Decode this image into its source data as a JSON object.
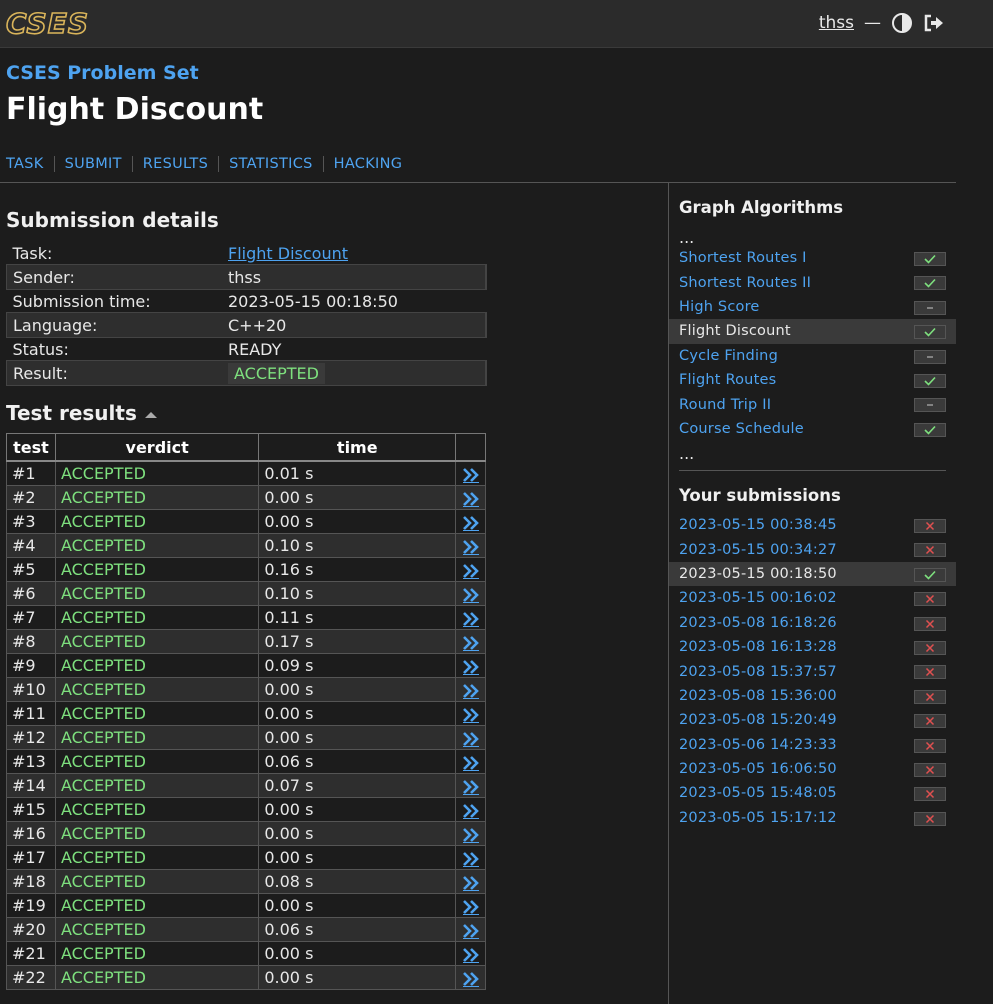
{
  "header": {
    "logo_text": "CSES",
    "username": "thss",
    "separator": "—",
    "theme_icon": "half-circle-contrast",
    "logout_icon": "sign-out-arrow"
  },
  "site": "CSES Problem Set",
  "title": "Flight Discount",
  "tabs": [
    "TASK",
    "SUBMIT",
    "RESULTS",
    "STATISTICS",
    "HACKING"
  ],
  "details": {
    "heading": "Submission details",
    "rows": [
      {
        "label": "Task:",
        "value": "Flight Discount"
      },
      {
        "label": "Sender:",
        "value": "thss"
      },
      {
        "label": "Submission time:",
        "value": "2023-05-15 00:18:50"
      },
      {
        "label": "Language:",
        "value": "C++20"
      },
      {
        "label": "Status:",
        "value": "READY"
      },
      {
        "label": "Result:",
        "value": "ACCEPTED"
      }
    ]
  },
  "tests": {
    "heading": "Test results",
    "columns": [
      "test",
      "verdict",
      "time"
    ],
    "rows": [
      {
        "test": "#1",
        "verdict": "ACCEPTED",
        "time": "0.01 s"
      },
      {
        "test": "#2",
        "verdict": "ACCEPTED",
        "time": "0.00 s"
      },
      {
        "test": "#3",
        "verdict": "ACCEPTED",
        "time": "0.00 s"
      },
      {
        "test": "#4",
        "verdict": "ACCEPTED",
        "time": "0.10 s"
      },
      {
        "test": "#5",
        "verdict": "ACCEPTED",
        "time": "0.16 s"
      },
      {
        "test": "#6",
        "verdict": "ACCEPTED",
        "time": "0.10 s"
      },
      {
        "test": "#7",
        "verdict": "ACCEPTED",
        "time": "0.11 s"
      },
      {
        "test": "#8",
        "verdict": "ACCEPTED",
        "time": "0.17 s"
      },
      {
        "test": "#9",
        "verdict": "ACCEPTED",
        "time": "0.09 s"
      },
      {
        "test": "#10",
        "verdict": "ACCEPTED",
        "time": "0.00 s"
      },
      {
        "test": "#11",
        "verdict": "ACCEPTED",
        "time": "0.00 s"
      },
      {
        "test": "#12",
        "verdict": "ACCEPTED",
        "time": "0.00 s"
      },
      {
        "test": "#13",
        "verdict": "ACCEPTED",
        "time": "0.06 s"
      },
      {
        "test": "#14",
        "verdict": "ACCEPTED",
        "time": "0.07 s"
      },
      {
        "test": "#15",
        "verdict": "ACCEPTED",
        "time": "0.00 s"
      },
      {
        "test": "#16",
        "verdict": "ACCEPTED",
        "time": "0.00 s"
      },
      {
        "test": "#17",
        "verdict": "ACCEPTED",
        "time": "0.00 s"
      },
      {
        "test": "#18",
        "verdict": "ACCEPTED",
        "time": "0.08 s"
      },
      {
        "test": "#19",
        "verdict": "ACCEPTED",
        "time": "0.00 s"
      },
      {
        "test": "#20",
        "verdict": "ACCEPTED",
        "time": "0.06 s"
      },
      {
        "test": "#21",
        "verdict": "ACCEPTED",
        "time": "0.00 s"
      },
      {
        "test": "#22",
        "verdict": "ACCEPTED",
        "time": "0.00 s"
      }
    ]
  },
  "sidebar": {
    "category": "Graph Algorithms",
    "ellipsis": "...",
    "problems": [
      {
        "name": "Shortest Routes I",
        "status": "solved"
      },
      {
        "name": "Shortest Routes II",
        "status": "solved"
      },
      {
        "name": "High Score",
        "status": "none"
      },
      {
        "name": "Flight Discount",
        "status": "solved",
        "current": true
      },
      {
        "name": "Cycle Finding",
        "status": "none"
      },
      {
        "name": "Flight Routes",
        "status": "solved"
      },
      {
        "name": "Round Trip II",
        "status": "none"
      },
      {
        "name": "Course Schedule",
        "status": "solved"
      }
    ],
    "submissions_heading": "Your submissions",
    "submissions": [
      {
        "time": "2023-05-15 00:38:45",
        "status": "failed"
      },
      {
        "time": "2023-05-15 00:34:27",
        "status": "failed"
      },
      {
        "time": "2023-05-15 00:18:50",
        "status": "solved",
        "current": true
      },
      {
        "time": "2023-05-15 00:16:02",
        "status": "failed"
      },
      {
        "time": "2023-05-08 16:18:26",
        "status": "failed"
      },
      {
        "time": "2023-05-08 16:13:28",
        "status": "failed"
      },
      {
        "time": "2023-05-08 15:37:57",
        "status": "failed"
      },
      {
        "time": "2023-05-08 15:36:00",
        "status": "failed"
      },
      {
        "time": "2023-05-08 15:20:49",
        "status": "failed"
      },
      {
        "time": "2023-05-06 14:23:33",
        "status": "failed"
      },
      {
        "time": "2023-05-05 16:06:50",
        "status": "failed"
      },
      {
        "time": "2023-05-05 15:48:05",
        "status": "failed"
      },
      {
        "time": "2023-05-05 15:17:12",
        "status": "failed"
      }
    ]
  },
  "colors": {
    "link": "#4ea3f0",
    "accepted": "#7ee07e",
    "failed": "#e05050",
    "background": "#1c1c1c"
  }
}
